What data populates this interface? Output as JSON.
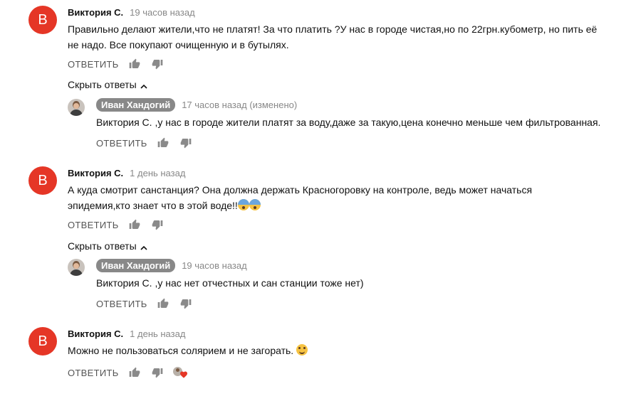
{
  "labels": {
    "reply": "ОТВЕТИТЬ",
    "hide_replies": "Скрыть ответы"
  },
  "icons": {
    "like": "thumbs-up-icon",
    "dislike": "thumbs-down-icon",
    "collapse": "chevron-up-icon",
    "creator_heart": "heart-icon"
  },
  "colors": {
    "avatar_bg": "#e53626",
    "creator_badge_bg": "#888888",
    "heart": "#e53626",
    "icon_gray": "#8a8a8a"
  },
  "threads": [
    {
      "author": "Виктория С.",
      "avatar_letter": "В",
      "time": "19 часов назад",
      "text": "Правильно делают жители,что не платят! За что платить ?У нас в городе чистая,но по 22грн.кубометр, но пить её не надо. Все покупают очищенную и в бутылях.",
      "reply": {
        "author": "Иван Хандогий",
        "time": "17 часов назад (изменено)",
        "text": "Виктория С. ,у нас в городе жители платят за воду,даже за такую,цена конечно меньше чем фильтрованная."
      }
    },
    {
      "author": "Виктория С.",
      "avatar_letter": "В",
      "time": "1 день назад",
      "text": "А куда смотрит санстанция? Она должна держать Красногоровку на контроле, ведь может начаться эпидемия,кто знает что в этой воде!!",
      "emoji": "fearful-face-emoji",
      "reply": {
        "author": "Иван Хандогий",
        "time": "19 часов назад",
        "text": "Виктория С. ,у нас нет отчестных и сан станции тоже нет)"
      }
    },
    {
      "author": "Виктория С.",
      "avatar_letter": "В",
      "time": "1 день назад",
      "text": "Можно не пользоваться солярием и не загорать.",
      "emoji": "smiling-face-emoji",
      "creator_hearted": true
    }
  ]
}
